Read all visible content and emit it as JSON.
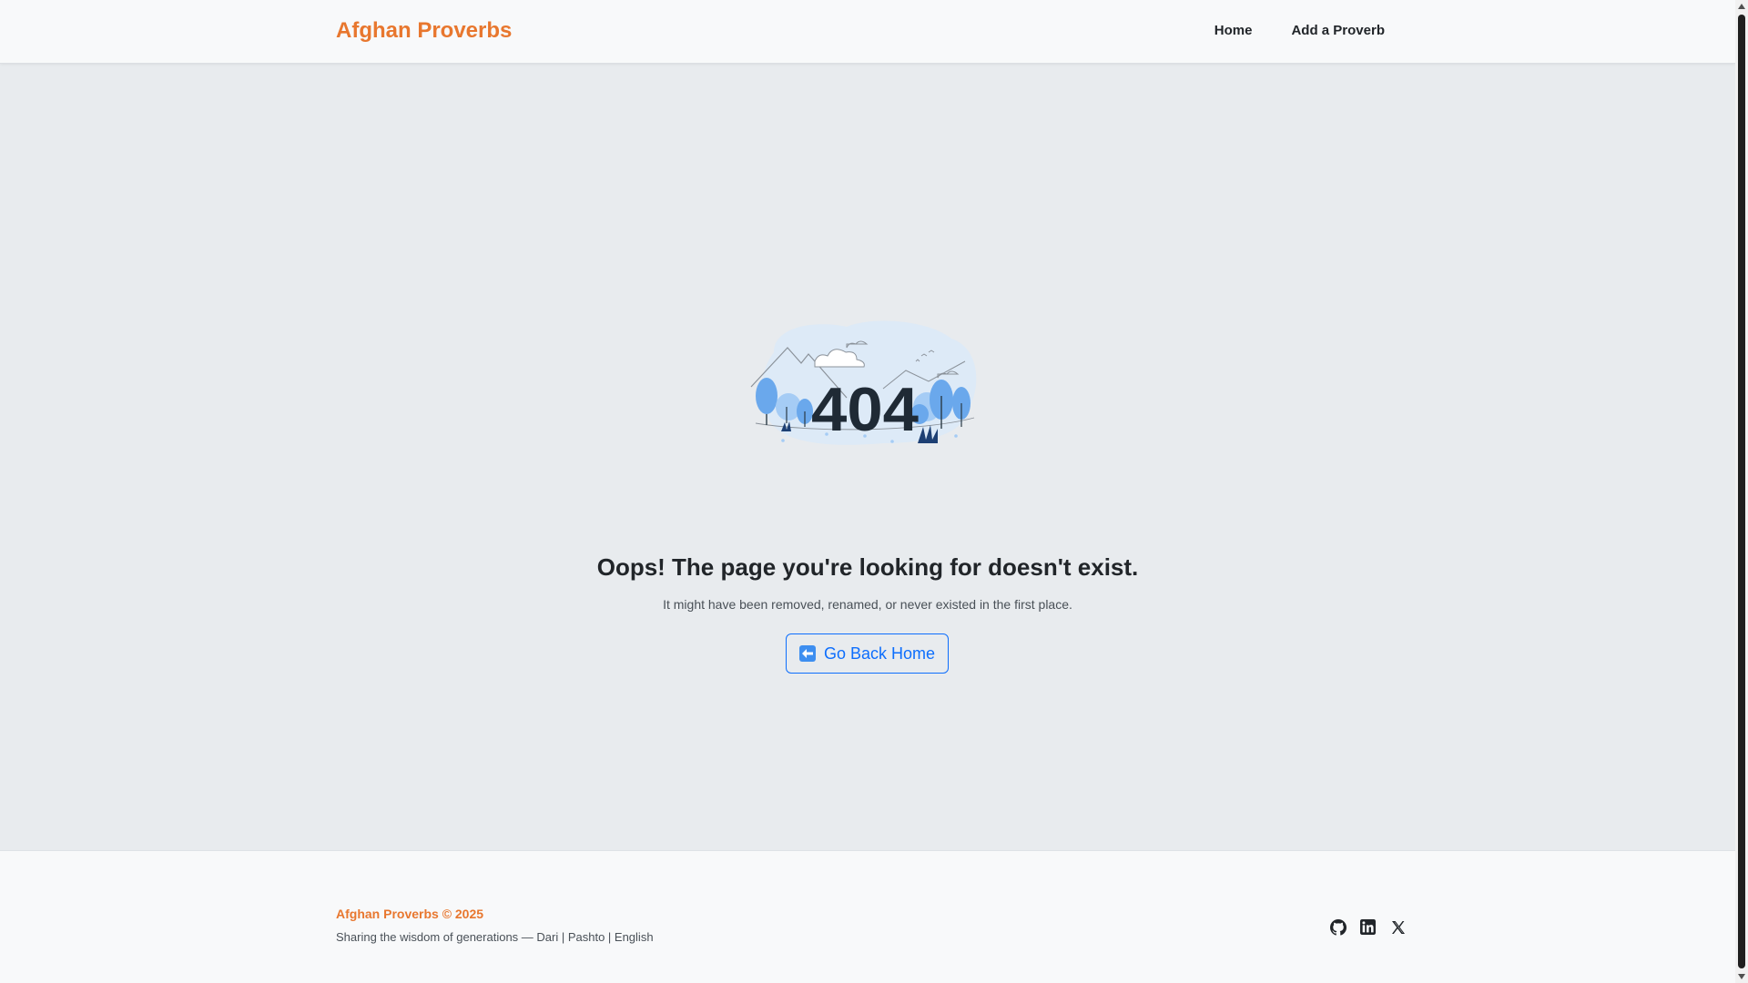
{
  "navbar": {
    "brand": "Afghan Proverbs",
    "links": [
      {
        "label": "Home"
      },
      {
        "label": "Add a Proverb"
      }
    ]
  },
  "main": {
    "illustration_text": "404",
    "heading": "Oops! The page you're looking for doesn't exist.",
    "subtext": "It might have been removed, renamed, or never existed in the first place.",
    "button_label": "Go Back Home",
    "button_icon": "arrow-left-icon"
  },
  "footer": {
    "brand": "Afghan Proverbs © 2025",
    "tagline": "Sharing the wisdom of generations — Dari | Pashto | English",
    "social_icons": [
      "github-icon",
      "linkedin-icon",
      "x-icon"
    ]
  },
  "colors": {
    "brand": "#e8772e",
    "primary": "#0d6efd",
    "page_bg": "#e8ebee",
    "navbar_bg": "#f8f9fa"
  }
}
